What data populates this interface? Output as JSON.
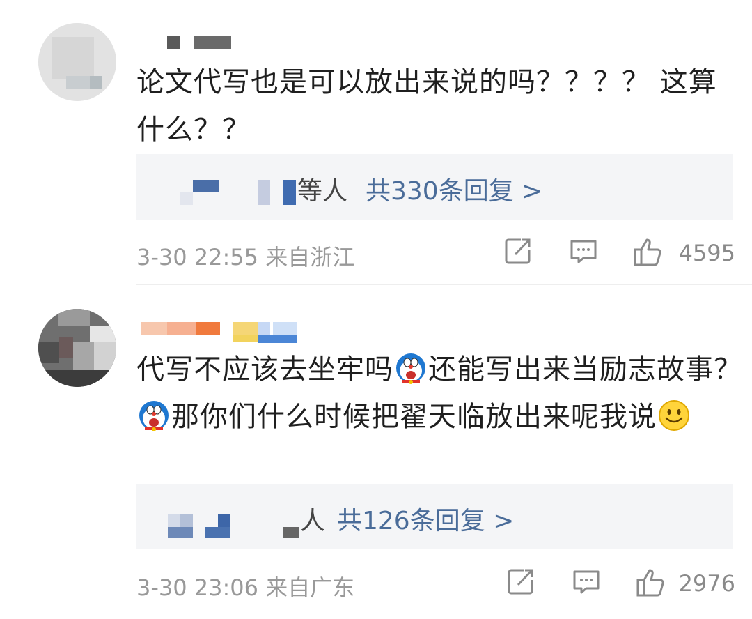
{
  "comments": [
    {
      "text": "论文代写也是可以放出来说的吗？？？？ 这算什么？？",
      "reply_suffix": "等人",
      "reply_count": "共330条回复 >",
      "time": "3-30 22:55 来自浙江",
      "likes": "4595"
    },
    {
      "text_part1": "代写不应该去坐牢吗",
      "text_part2": "还能写出来当励志故事？ ",
      "text_part3": "那你们什么时候把翟天临放出来呢我说",
      "reply_suffix": "人",
      "reply_count": "共126条回复 >",
      "time": "3-30 23:06 来自广东",
      "likes": "2976"
    }
  ],
  "icons": {
    "share": "share-icon",
    "comment": "comment-icon",
    "like": "thumbs-up-icon",
    "emoji_doraemon": "doraemon-emoji-icon",
    "emoji_smile": "smile-emoji-icon"
  },
  "colors": {
    "link": "#4a6c99",
    "meta": "#999999",
    "reply_bg": "#f4f5f7"
  }
}
